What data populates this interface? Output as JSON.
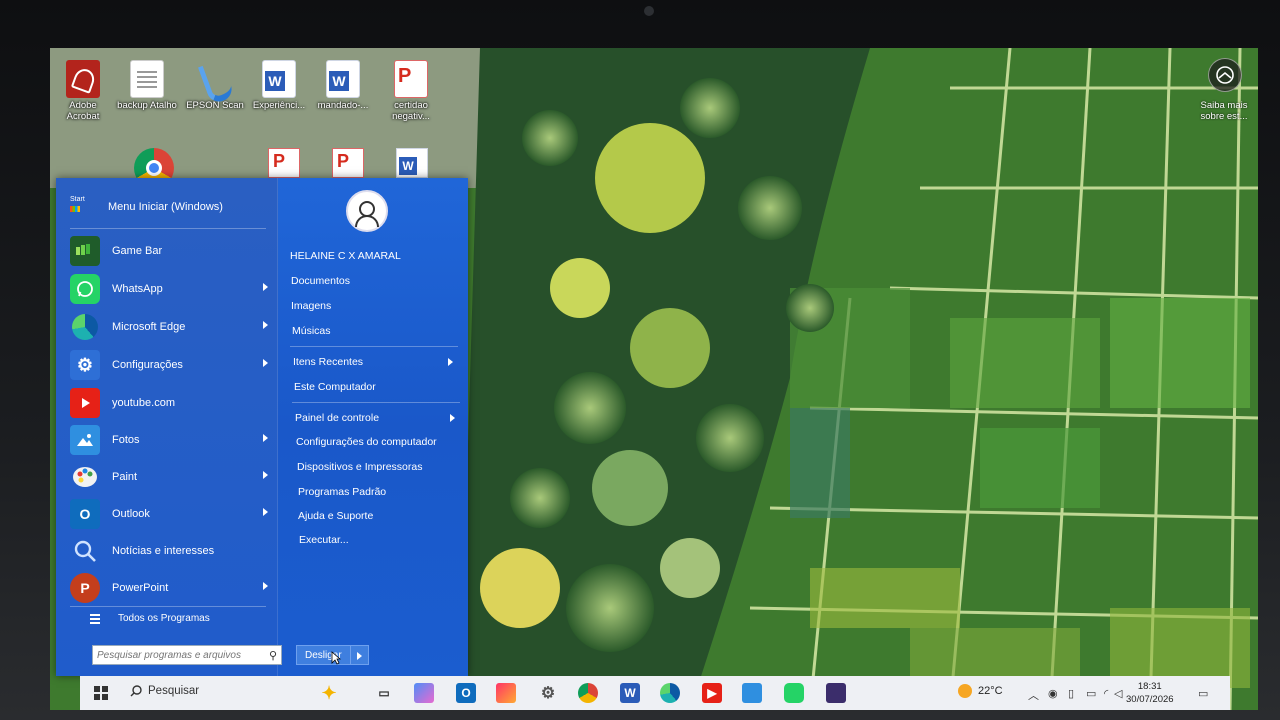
{
  "desktop": {
    "icons": [
      {
        "label": "Adobe Acrobat",
        "kind": "acrobat"
      },
      {
        "label": "backup Atalho",
        "kind": "doc"
      },
      {
        "label": "EPSON Scan",
        "kind": "epson"
      },
      {
        "label": "Experiênci...",
        "kind": "word"
      },
      {
        "label": "mandado-...",
        "kind": "word"
      },
      {
        "label": "certidao negativ...",
        "kind": "pdf"
      }
    ],
    "spotlight_label": "Saiba mais sobre est..."
  },
  "start_menu": {
    "badge": "Start",
    "header_title": "Menu Iniciar (Windows)",
    "apps": [
      {
        "label": "Game Bar",
        "icon": "gamebar-icon",
        "color": "#2c9a3a",
        "has_submenu": false
      },
      {
        "label": "WhatsApp",
        "icon": "whatsapp-icon",
        "color": "#25d366",
        "has_submenu": true
      },
      {
        "label": "Microsoft Edge",
        "icon": "edge-icon",
        "color": "#1db1b0",
        "has_submenu": true
      },
      {
        "label": "Configurações",
        "icon": "gear-icon",
        "color": "#3a7bd5",
        "has_submenu": true
      },
      {
        "label": "youtube.com",
        "icon": "youtube-icon",
        "color": "#e62117",
        "has_submenu": false
      },
      {
        "label": "Fotos",
        "icon": "photos-icon",
        "color": "#2f8fe0",
        "has_submenu": true
      },
      {
        "label": "Paint",
        "icon": "paint-icon",
        "color": "#e9eef5",
        "has_submenu": true
      },
      {
        "label": "Outlook",
        "icon": "outlook-icon",
        "color": "#0f6cbd",
        "has_submenu": true
      },
      {
        "label": "Notícias e interesses",
        "icon": "news-icon",
        "color": "#1f62d0",
        "has_submenu": false
      },
      {
        "label": "PowerPoint",
        "icon": "powerpoint-icon",
        "color": "#c43e1c",
        "has_submenu": true
      }
    ],
    "all_programs": "Todos os Programas",
    "search_placeholder": "Pesquisar programas e arquivos",
    "user_name": "HELAINE C X  AMARAL",
    "places": [
      "Documentos",
      "Imagens",
      "Músicas"
    ],
    "recent": [
      {
        "label": "Itens Recentes",
        "has_submenu": true
      },
      {
        "label": "Este Computador",
        "has_submenu": false
      }
    ],
    "system": [
      {
        "label": "Painel de controle",
        "has_submenu": true
      },
      {
        "label": "Configurações do computador",
        "has_submenu": false
      },
      {
        "label": "Dispositivos e Impressoras",
        "has_submenu": false
      },
      {
        "label": "Programas Padrão",
        "has_submenu": false
      },
      {
        "label": "Ajuda e Suporte",
        "has_submenu": false
      },
      {
        "label": "Executar...",
        "has_submenu": false
      }
    ],
    "shutdown_label": "Desligar"
  },
  "taskbar": {
    "search_label": "Pesquisar",
    "apps": [
      "copilot-icon",
      "task-view-icon",
      "copilot-app-icon",
      "outlook-icon",
      "paint-icon",
      "settings-icon",
      "chrome-icon",
      "word-icon",
      "edge-icon",
      "youtube-icon",
      "photos-icon",
      "whatsapp-icon",
      "app-icon"
    ],
    "weather_temp": "22°C",
    "time": "18:31",
    "date": "30/07/2026"
  }
}
